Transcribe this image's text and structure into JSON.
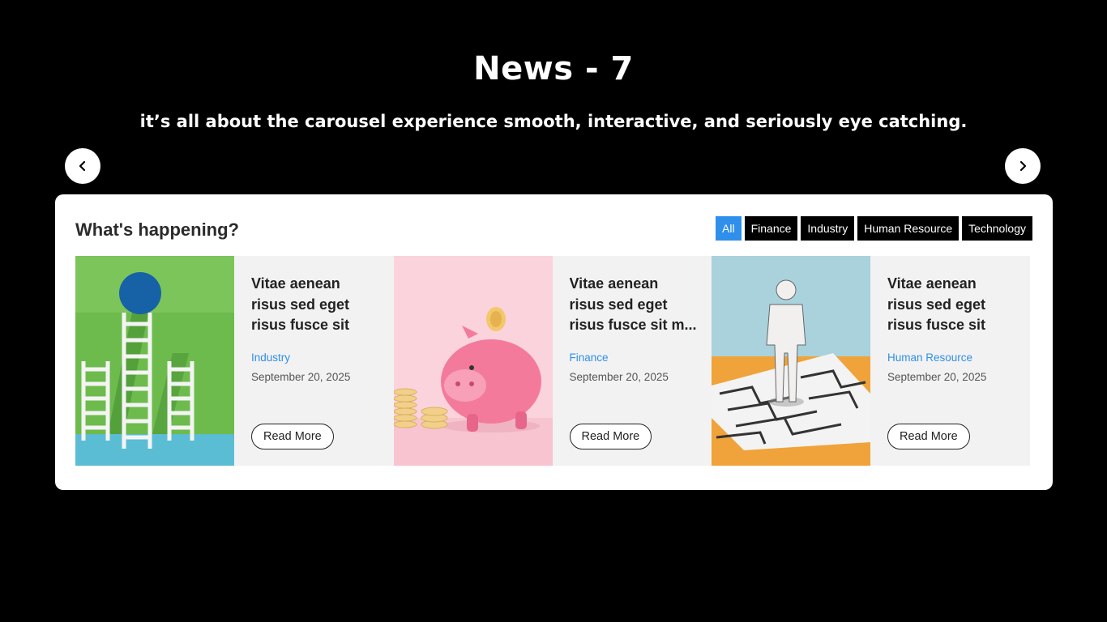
{
  "hero": {
    "title": "News - 7",
    "subtitle": "it’s all about the carousel experience smooth, interactive, and seriously eye catching."
  },
  "panel": {
    "heading": "What's happening?"
  },
  "filters": [
    {
      "label": "All",
      "active": true
    },
    {
      "label": "Finance",
      "active": false
    },
    {
      "label": "Industry",
      "active": false
    },
    {
      "label": "Human Resource",
      "active": false
    },
    {
      "label": "Technology",
      "active": false
    }
  ],
  "cards": [
    {
      "title": "Vitae aenean risus sed eget risus fusce sit mattis a...",
      "category": "Industry",
      "date": "September 20, 2025",
      "button": "Read More",
      "image_icon": "ladders-goal-image"
    },
    {
      "title": "Vitae aenean risus sed eget risus fusce sit m...",
      "category": "Finance",
      "date": "September 20, 2025",
      "button": "Read More",
      "image_icon": "piggy-bank-image"
    },
    {
      "title": "Vitae aenean risus sed eget risus fusce sit mattis a...",
      "category": "Human Resource",
      "date": "September 20, 2025",
      "button": "Read More",
      "image_icon": "maze-figure-image"
    }
  ],
  "nav": {
    "prev_icon": "chevron-left-icon",
    "next_icon": "chevron-right-icon"
  },
  "colors": {
    "page_background": "#000000",
    "accent": "#2f8fea",
    "filter_background": "#000000",
    "card_body": "#f2f2f2"
  }
}
